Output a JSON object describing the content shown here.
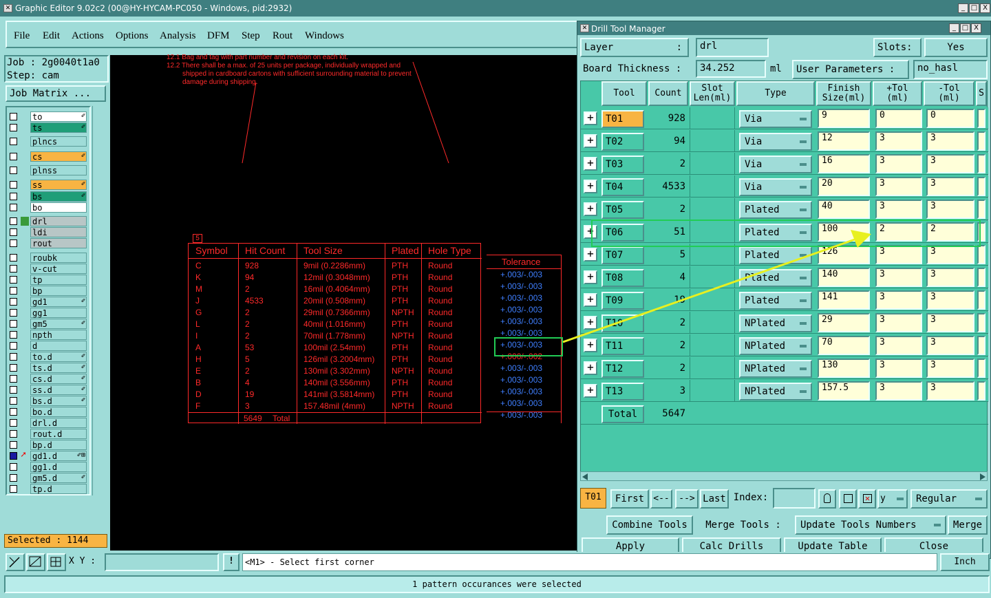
{
  "window": {
    "title": "Graphic Editor 9.02c2 (00@HY-HYCAM-PC050 - Windows, pid:2932)",
    "min": "_",
    "max": "□",
    "close": "X"
  },
  "menu": [
    "File",
    "Edit",
    "Actions",
    "Options",
    "Analysis",
    "DFM",
    "Step",
    "Rout",
    "Windows"
  ],
  "left": {
    "job": "Job : 2g0040t1a0",
    "step": "Step: cam",
    "job_matrix": "Job Matrix ...",
    "selected": "Selected : 1144",
    "layers": [
      {
        "name": "to",
        "bg": "#ffffff",
        "edit": "✐"
      },
      {
        "name": "ts",
        "bg": "#1f9e78",
        "edit": "✐"
      },
      {
        "name": "plncs",
        "bg": "#9fdcd8",
        "edit": ""
      },
      {
        "name": "cs",
        "bg": "#f8b443",
        "edit": "✐"
      },
      {
        "name": "plnss",
        "bg": "#9fdcd8",
        "edit": ""
      },
      {
        "name": "ss",
        "bg": "#f8b443",
        "edit": "✐"
      },
      {
        "name": "bs",
        "bg": "#1f9e78",
        "edit": "✐"
      },
      {
        "name": "bo",
        "bg": "#ffffff",
        "edit": ""
      },
      {
        "name": "drl",
        "bg": "#b8c6c6",
        "edit": ""
      },
      {
        "name": "ldi",
        "bg": "#b8c6c6",
        "edit": ""
      },
      {
        "name": "rout",
        "bg": "#b8c6c6",
        "edit": ""
      },
      {
        "name": "roubk",
        "bg": "#9fdcd8",
        "edit": ""
      },
      {
        "name": "v-cut",
        "bg": "#9fdcd8",
        "edit": ""
      },
      {
        "name": "tp",
        "bg": "#9fdcd8",
        "edit": ""
      },
      {
        "name": "bp",
        "bg": "#9fdcd8",
        "edit": ""
      },
      {
        "name": "gd1",
        "bg": "#9fdcd8",
        "edit": "✐"
      },
      {
        "name": "gg1",
        "bg": "#9fdcd8",
        "edit": ""
      },
      {
        "name": "gm5",
        "bg": "#9fdcd8",
        "edit": "✐"
      },
      {
        "name": "npth",
        "bg": "#9fdcd8",
        "edit": ""
      },
      {
        "name": "d",
        "bg": "#9fdcd8",
        "edit": ""
      },
      {
        "name": "to.d",
        "bg": "#9fdcd8",
        "edit": "✐"
      },
      {
        "name": "ts.d",
        "bg": "#9fdcd8",
        "edit": "✐"
      },
      {
        "name": "cs.d",
        "bg": "#9fdcd8",
        "edit": "✐"
      },
      {
        "name": "ss.d",
        "bg": "#9fdcd8",
        "edit": "✐"
      },
      {
        "name": "bs.d",
        "bg": "#9fdcd8",
        "edit": "✐"
      },
      {
        "name": "bo.d",
        "bg": "#9fdcd8",
        "edit": ""
      },
      {
        "name": "drl.d",
        "bg": "#9fdcd8",
        "edit": ""
      },
      {
        "name": "rout.d",
        "bg": "#9fdcd8",
        "edit": ""
      },
      {
        "name": "bp.d",
        "bg": "#9fdcd8",
        "edit": ""
      },
      {
        "name": "gd1.d",
        "bg": "#9fdcd8",
        "edit": "✐⊞"
      },
      {
        "name": "gg1.d",
        "bg": "#9fdcd8",
        "edit": ""
      },
      {
        "name": "gm5.d",
        "bg": "#9fdcd8",
        "edit": "✐"
      },
      {
        "name": "tp.d",
        "bg": "#9fdcd8",
        "edit": ""
      }
    ]
  },
  "canvas": {
    "notes": [
      "12.1 Bag and tag with part number and revision on each kit.",
      "12.2 There shall be a max. of 25 units per package, individually wrapped and",
      "shipped in cardboard cartons with sufficient surrounding material to prevent",
      "damage during shipping."
    ],
    "marker": "5",
    "headers": [
      "Symbol",
      "Hit Count",
      "Tool Size",
      "Plated",
      "Hole Type"
    ],
    "rows": [
      [
        "C",
        "928",
        "9mil (0.2286mm)",
        "PTH",
        "Round"
      ],
      [
        "K",
        "94",
        "12mil (0.3048mm)",
        "PTH",
        "Round"
      ],
      [
        "M",
        "2",
        "16mil (0.4064mm)",
        "PTH",
        "Round"
      ],
      [
        "J",
        "4533",
        "20mil (0.508mm)",
        "PTH",
        "Round"
      ],
      [
        "G",
        "2",
        "29mil (0.7366mm)",
        "NPTH",
        "Round"
      ],
      [
        "L",
        "2",
        "40mil (1.016mm)",
        "PTH",
        "Round"
      ],
      [
        "I",
        "2",
        "70mil (1.778mm)",
        "NPTH",
        "Round"
      ],
      [
        "A",
        "53",
        "100mil (2.54mm)",
        "PTH",
        "Round"
      ],
      [
        "H",
        "5",
        "126mil (3.2004mm)",
        "PTH",
        "Round"
      ],
      [
        "E",
        "2",
        "130mil (3.302mm)",
        "NPTH",
        "Round"
      ],
      [
        "B",
        "4",
        "140mil (3.556mm)",
        "PTH",
        "Round"
      ],
      [
        "D",
        "19",
        "141mil (3.5814mm)",
        "PTH",
        "Round"
      ],
      [
        "F",
        "3",
        "157.48mil (4mm)",
        "NPTH",
        "Round"
      ]
    ],
    "total_count": "5649",
    "total_label": "Total",
    "tolerance_header": "Tolerance",
    "tolerances": [
      "+.003/-.003",
      "+.003/-.003",
      "+.003/-.003",
      "+.003/-.003",
      "+.003/-.003",
      "+.003/-.003",
      "+.003/-.003",
      "+.000/-.002",
      "+.003/-.003",
      "+.003/-.003",
      "+.003/-.003",
      "+.003/-.003",
      "+.003/-.003"
    ]
  },
  "dtm": {
    "title": "Drill Tool Manager",
    "layer_label": "Layer",
    "layer_colon": ":",
    "layer_value": "drl",
    "slots_label": "Slots:",
    "slots_value": "Yes",
    "thickness_label": "Board Thickness :",
    "thickness_value": "34.252",
    "thickness_unit": "ml",
    "user_params_label": "User Parameters :",
    "user_params_value": "no_hasl",
    "headers": {
      "tool": "Tool",
      "count": "Count",
      "slot1": "Slot",
      "slot2": "Len(ml)",
      "type": "Type",
      "finish1": "Finish",
      "finish2": "Size(ml)",
      "ptol1": "+Tol",
      "ptol2": "(ml)",
      "ntol1": "-Tol",
      "ntol2": "(ml)",
      "extra": "S"
    },
    "tools": [
      {
        "tool": "T01",
        "count": "928",
        "type": "Via",
        "finish": "9",
        "ptol": "0",
        "ntol": "0"
      },
      {
        "tool": "T02",
        "count": "94",
        "type": "Via",
        "finish": "12",
        "ptol": "3",
        "ntol": "3"
      },
      {
        "tool": "T03",
        "count": "2",
        "type": "Via",
        "finish": "16",
        "ptol": "3",
        "ntol": "3"
      },
      {
        "tool": "T04",
        "count": "4533",
        "type": "Via",
        "finish": "20",
        "ptol": "3",
        "ntol": "3"
      },
      {
        "tool": "T05",
        "count": "2",
        "type": "Plated",
        "finish": "40",
        "ptol": "3",
        "ntol": "3"
      },
      {
        "tool": "T06",
        "count": "51",
        "type": "Plated",
        "finish": "100",
        "ptol": "2",
        "ntol": "2"
      },
      {
        "tool": "T07",
        "count": "5",
        "type": "Plated",
        "finish": "126",
        "ptol": "3",
        "ntol": "3"
      },
      {
        "tool": "T08",
        "count": "4",
        "type": "Plated",
        "finish": "140",
        "ptol": "3",
        "ntol": "3"
      },
      {
        "tool": "T09",
        "count": "19",
        "type": "Plated",
        "finish": "141",
        "ptol": "3",
        "ntol": "3"
      },
      {
        "tool": "T10",
        "count": "2",
        "type": "NPlated",
        "finish": "29",
        "ptol": "3",
        "ntol": "3"
      },
      {
        "tool": "T11",
        "count": "2",
        "type": "NPlated",
        "finish": "70",
        "ptol": "3",
        "ntol": "3"
      },
      {
        "tool": "T12",
        "count": "2",
        "type": "NPlated",
        "finish": "130",
        "ptol": "3",
        "ntol": "3"
      },
      {
        "tool": "T13",
        "count": "3",
        "type": "NPlated",
        "finish": "157.5",
        "ptol": "3",
        "ntol": "3"
      }
    ],
    "total_label": "Total",
    "total_value": "5647",
    "nav": {
      "current": "T01",
      "first": "First",
      "prev": "<--",
      "next": "-->",
      "last": "Last",
      "index_label": "Index:",
      "index_value": "",
      "y_label": "y",
      "mode": "Regular"
    },
    "buttons": {
      "combine": "Combine Tools",
      "merge_tools": "Merge Tools :",
      "update_numbers": "Update Tools Numbers",
      "merge": "Merge",
      "apply": "Apply",
      "calc": "Calc Drills",
      "update_table": "Update Table",
      "close": "Close"
    }
  },
  "bottom": {
    "xy_label": "X Y :",
    "xy_value": "",
    "exclaim": "!",
    "prompt": "<M1> - Select first corner",
    "units": "Inch",
    "status": "1 pattern occurances were selected"
  },
  "colors": {
    "highlight_box": "#22cc55",
    "arrow": "#e8f020",
    "drawing": "#ff2a2a",
    "tolerance": "#3f7fff"
  }
}
